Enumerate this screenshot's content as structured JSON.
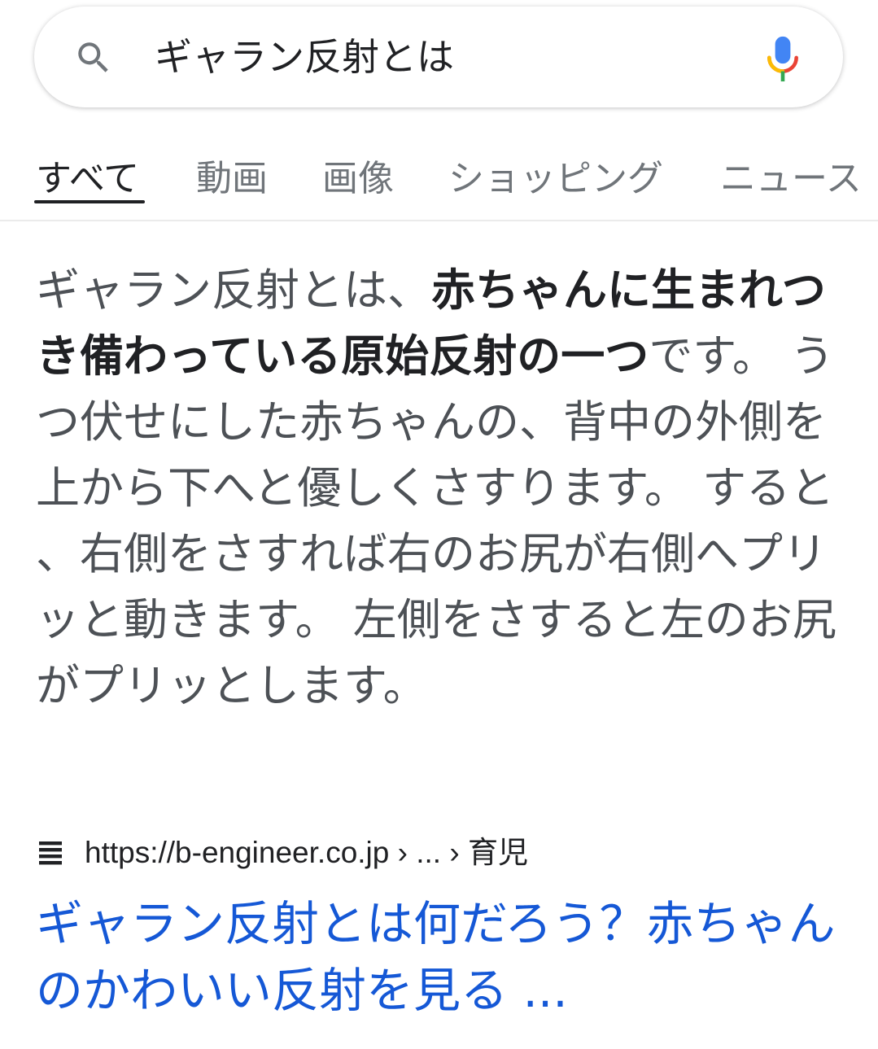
{
  "search": {
    "query": "ギャラン反射とは"
  },
  "tabs": [
    {
      "label": "すべて"
    },
    {
      "label": "動画"
    },
    {
      "label": "画像"
    },
    {
      "label": "ショッピング"
    },
    {
      "label": "ニュース"
    }
  ],
  "snippet": {
    "prefix": "ギャラン反射とは、",
    "bold": "赤ちゃんに生まれつき備わっている原始反射の一つ",
    "suffix": "です。 うつ伏せにした赤ちゃんの、背中の外側を上から下へと優しくさすります。 すると、右側をさすれば右のお尻が右側へプリッと動きます。 左側をさすると左のお尻がプリッとします。"
  },
  "result": {
    "url": "https://b-engineer.co.jp › ... › 育児",
    "title": "ギャラン反射とは何だろう？赤ちゃんのかわいい反射を見る ..."
  },
  "colors": {
    "link": "#1558d6",
    "text": "#4d5156"
  },
  "icons": {
    "search": "search-icon",
    "mic": "mic-icon",
    "site": "site-favicon-icon"
  }
}
